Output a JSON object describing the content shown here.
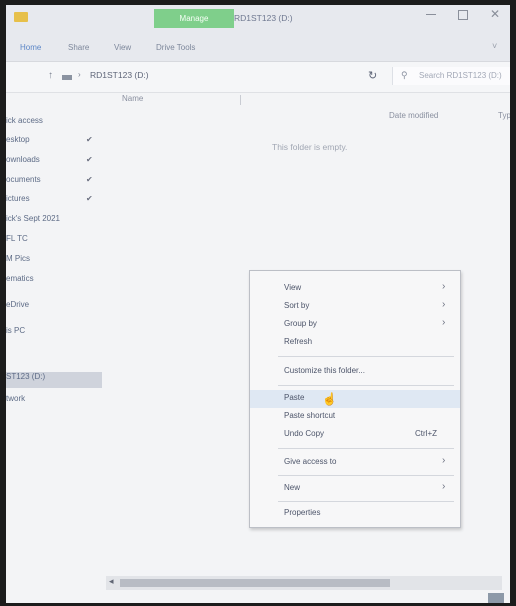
{
  "window": {
    "manage_tab": "Manage",
    "title": "RD1ST123 (D:)"
  },
  "ribbon": {
    "tabs": [
      "Home",
      "Share",
      "View",
      "Drive Tools"
    ]
  },
  "address": {
    "path": "RD1ST123 (D:)",
    "search_placeholder": "Search RD1ST123 (D:)"
  },
  "nav": {
    "items": [
      {
        "label": "ick access",
        "pinned": false
      },
      {
        "label": "esktop",
        "pinned": true
      },
      {
        "label": "ownloads",
        "pinned": true
      },
      {
        "label": "ocuments",
        "pinned": true
      },
      {
        "label": "ictures",
        "pinned": true
      },
      {
        "label": "ick's Sept 2021",
        "pinned": false
      },
      {
        "label": "FL TC",
        "pinned": false
      },
      {
        "label": "M Pics",
        "pinned": false
      },
      {
        "label": "ematics",
        "pinned": false
      },
      {
        "label": "eDrive",
        "pinned": false
      },
      {
        "label": "is PC",
        "pinned": false
      },
      {
        "label": "ST123 (D:)",
        "pinned": false
      },
      {
        "label": "twork",
        "pinned": false
      }
    ],
    "pin_glyph": "✔"
  },
  "columns": {
    "name": "Name",
    "date_modified": "Date modified",
    "type": "Typ"
  },
  "content": {
    "empty_message": "This folder is empty."
  },
  "context_menu": {
    "view": "View",
    "sort_by": "Sort by",
    "group_by": "Group by",
    "refresh": "Refresh",
    "customize": "Customize this folder...",
    "paste": "Paste",
    "paste_shortcut": "Paste shortcut",
    "undo_copy": "Undo Copy",
    "undo_shortcut": "Ctrl+Z",
    "give_access": "Give access to",
    "new": "New",
    "properties": "Properties"
  }
}
